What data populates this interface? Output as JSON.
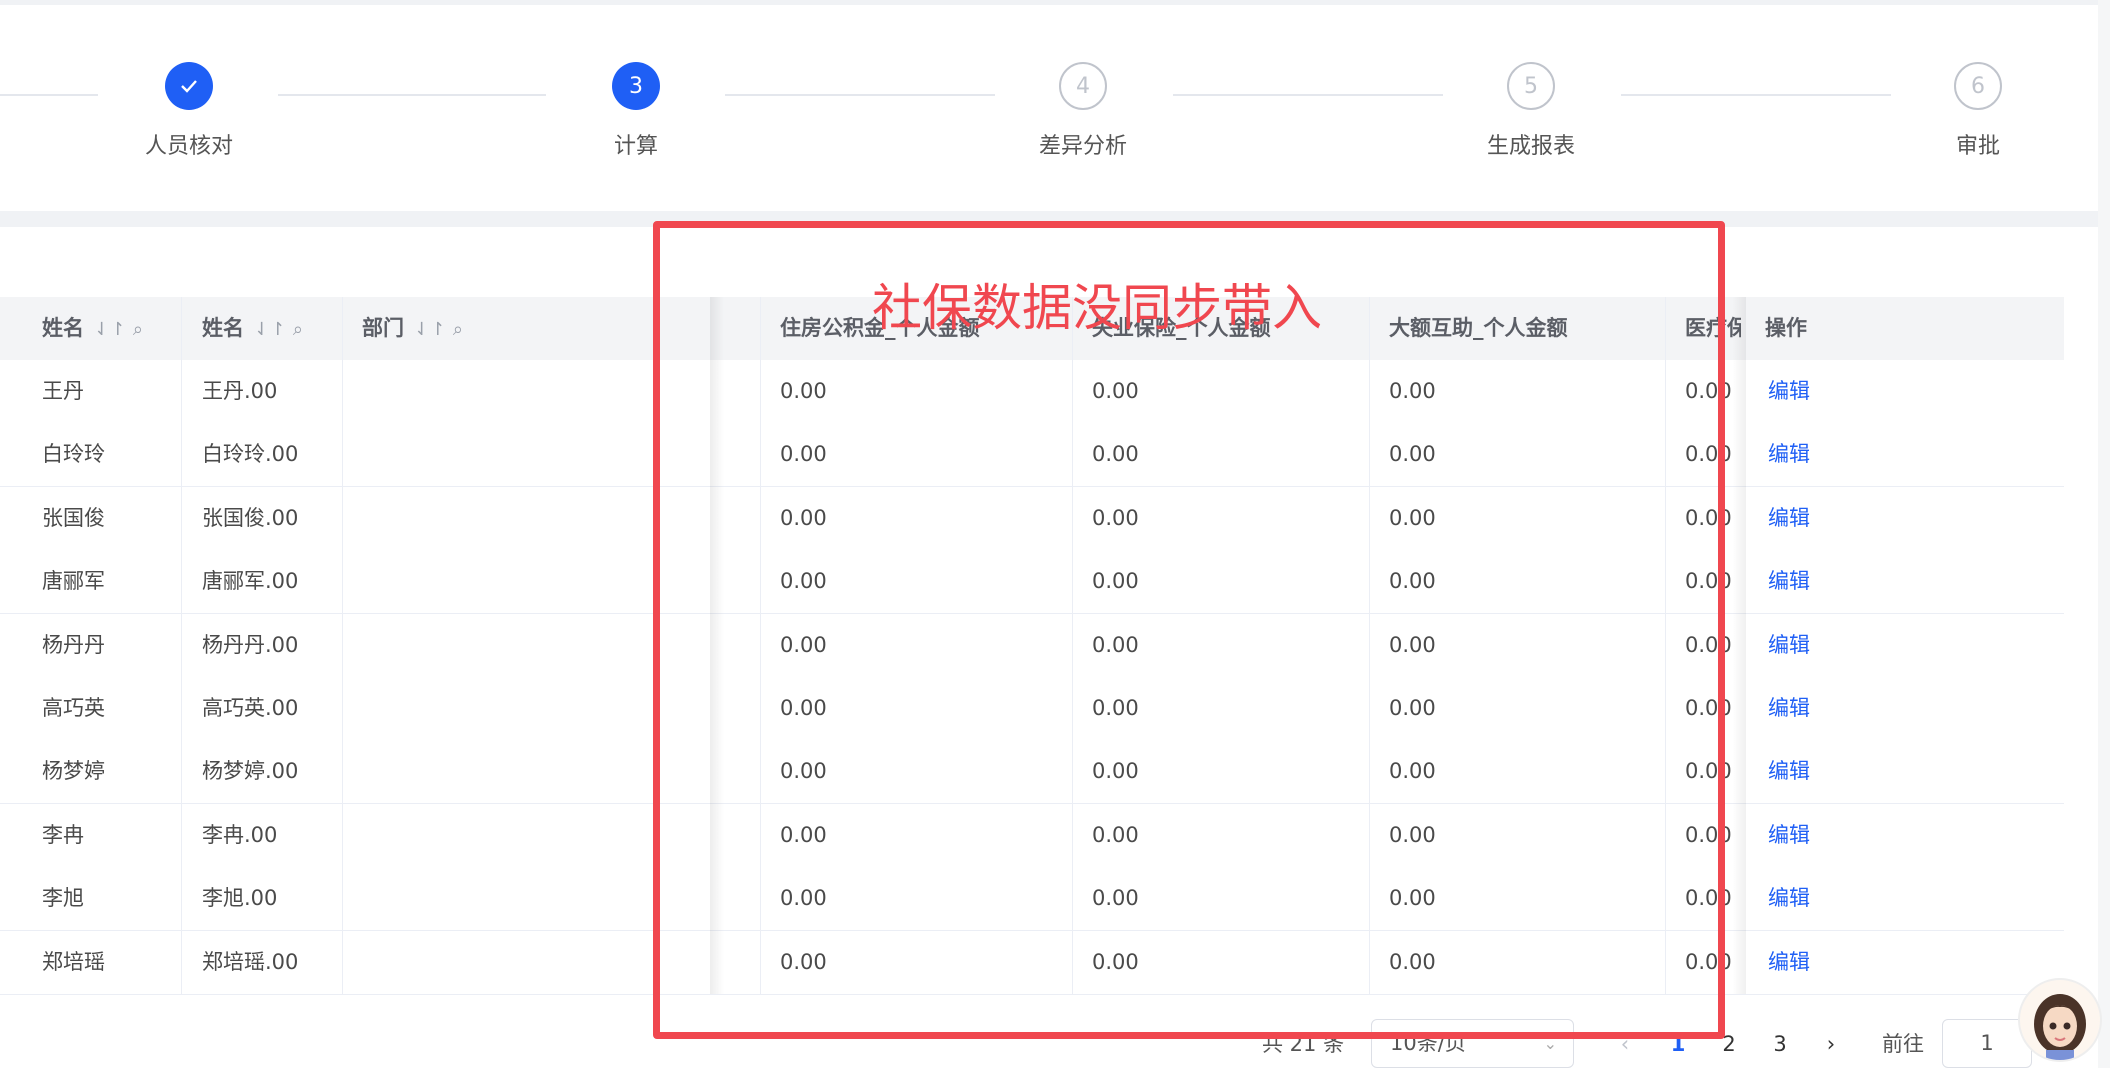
{
  "steps": [
    {
      "label": "人员核对",
      "number": "",
      "state": "done",
      "icon": "check-icon"
    },
    {
      "label": "计算",
      "number": "3",
      "state": "active"
    },
    {
      "label": "差异分析",
      "number": "4",
      "state": "wait"
    },
    {
      "label": "生成报表",
      "number": "5",
      "state": "wait"
    },
    {
      "label": "审批",
      "number": "6",
      "state": "wait"
    }
  ],
  "table": {
    "headers": {
      "name1": "姓名",
      "name2": "姓名",
      "dept": "部门",
      "housing": "住房公积金_个人金额",
      "unemployment": "失业保险_个人金额",
      "major_medical": "大额互助_个人金额",
      "medical": "医疗保",
      "ops": "操作"
    },
    "rows": [
      {
        "name": "王丹",
        "name2": "王丹.00",
        "dept": "",
        "housing": "0.00",
        "unemployment": "0.00",
        "major_medical": "0.00",
        "medical": "0.00",
        "action": "编辑"
      },
      {
        "name": "白玲玲",
        "name2": "白玲玲.00",
        "dept": "",
        "housing": "0.00",
        "unemployment": "0.00",
        "major_medical": "0.00",
        "medical": "0.00",
        "action": "编辑"
      },
      {
        "name": "张国俊",
        "name2": "张国俊.00",
        "dept": "",
        "housing": "0.00",
        "unemployment": "0.00",
        "major_medical": "0.00",
        "medical": "0.00",
        "action": "编辑"
      },
      {
        "name": "唐郦军",
        "name2": "唐郦军.00",
        "dept": "",
        "housing": "0.00",
        "unemployment": "0.00",
        "major_medical": "0.00",
        "medical": "0.00",
        "action": "编辑"
      },
      {
        "name": "杨丹丹",
        "name2": "杨丹丹.00",
        "dept": "",
        "housing": "0.00",
        "unemployment": "0.00",
        "major_medical": "0.00",
        "medical": "0.00",
        "action": "编辑"
      },
      {
        "name": "高巧英",
        "name2": "高巧英.00",
        "dept": "",
        "housing": "0.00",
        "unemployment": "0.00",
        "major_medical": "0.00",
        "medical": "0.00",
        "action": "编辑"
      },
      {
        "name": "杨梦婷",
        "name2": "杨梦婷.00",
        "dept": "",
        "housing": "0.00",
        "unemployment": "0.00",
        "major_medical": "0.00",
        "medical": "0.00",
        "action": "编辑"
      },
      {
        "name": "李冉",
        "name2": "李冉.00",
        "dept": "",
        "housing": "0.00",
        "unemployment": "0.00",
        "major_medical": "0.00",
        "medical": "0.00",
        "action": "编辑"
      },
      {
        "name": "李旭",
        "name2": "李旭.00",
        "dept": "",
        "housing": "0.00",
        "unemployment": "0.00",
        "major_medical": "0.00",
        "medical": "0.00",
        "action": "编辑"
      },
      {
        "name": "郑培瑶",
        "name2": "郑培瑶.00",
        "dept": "",
        "housing": "0.00",
        "unemployment": "0.00",
        "major_medical": "0.00",
        "medical": "0.00",
        "action": "编辑"
      }
    ]
  },
  "pagination": {
    "total_text": "共 21 条",
    "page_size": "10条/页",
    "pages": [
      "1",
      "2",
      "3"
    ],
    "current_page": "1",
    "goto_label": "前往",
    "goto_value": "1"
  },
  "annotation": {
    "text": "社保数据没同步带入",
    "color": "#f0474f"
  },
  "colors": {
    "primary": "#1f5ff5",
    "annotation": "#f0474f"
  }
}
